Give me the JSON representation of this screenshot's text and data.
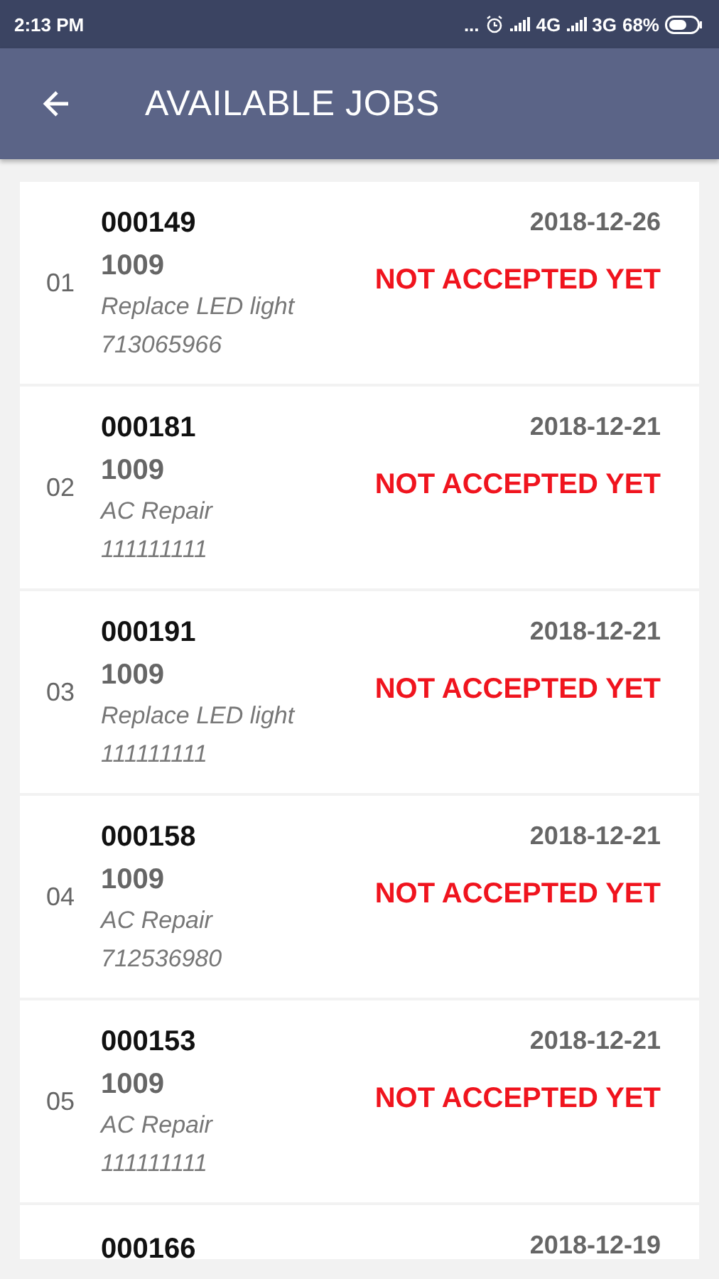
{
  "status_bar": {
    "time": "2:13 PM",
    "more": "...",
    "network_1": "4G",
    "network_2": "3G",
    "battery": "68%"
  },
  "app_bar": {
    "title": "AVAILABLE JOBS"
  },
  "jobs": [
    {
      "index": "01",
      "job_id": "000149",
      "code": "1009",
      "service": "Replace LED light",
      "phone": "713065966",
      "date": "2018-12-26",
      "status": "NOT ACCEPTED YET"
    },
    {
      "index": "02",
      "job_id": "000181",
      "code": "1009",
      "service": "AC Repair",
      "phone": "111111111",
      "date": "2018-12-21",
      "status": "NOT ACCEPTED YET"
    },
    {
      "index": "03",
      "job_id": "000191",
      "code": "1009",
      "service": "Replace LED light",
      "phone": "111111111",
      "date": "2018-12-21",
      "status": "NOT ACCEPTED YET"
    },
    {
      "index": "04",
      "job_id": "000158",
      "code": "1009",
      "service": "AC Repair",
      "phone": "712536980",
      "date": "2018-12-21",
      "status": "NOT ACCEPTED YET"
    },
    {
      "index": "05",
      "job_id": "000153",
      "code": "1009",
      "service": "AC Repair",
      "phone": "111111111",
      "date": "2018-12-21",
      "status": "NOT ACCEPTED YET"
    },
    {
      "job_id": "000166",
      "date": "2018-12-19"
    }
  ]
}
